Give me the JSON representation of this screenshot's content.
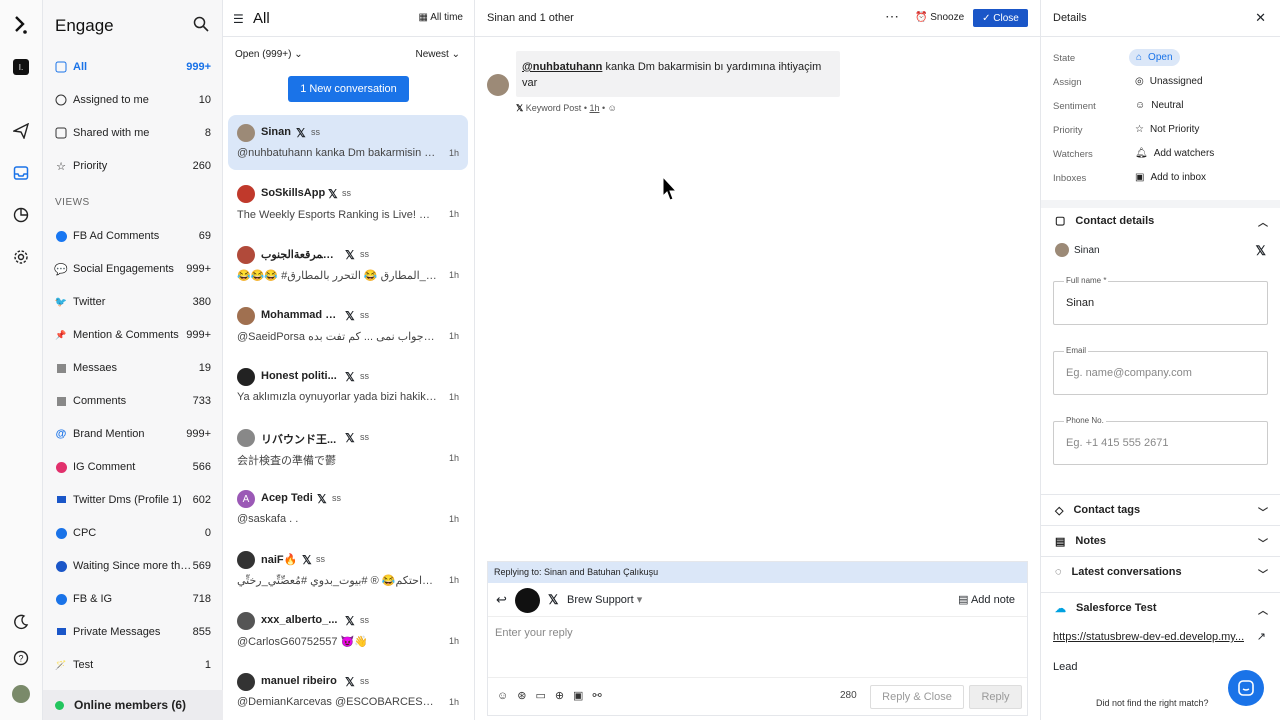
{
  "sidebar": {
    "title": "Engage",
    "views_heading": "VIEWS",
    "online": "Online members (6)",
    "items": [
      {
        "label": "All",
        "count": "999+"
      },
      {
        "label": "Assigned to me",
        "count": "10"
      },
      {
        "label": "Shared with me",
        "count": "8"
      },
      {
        "label": "Priority",
        "count": "260"
      }
    ],
    "views": [
      {
        "label": "FB Ad Comments",
        "count": "69",
        "icon": "facebook-icon"
      },
      {
        "label": "Social Engagements",
        "count": "999+",
        "icon": "speech-bubble-icon"
      },
      {
        "label": "Twitter",
        "count": "380",
        "icon": "twitter-icon"
      },
      {
        "label": "Mention & Comments",
        "count": "999+",
        "icon": "pin-icon"
      },
      {
        "label": "Messaes",
        "count": "19",
        "icon": "list-icon"
      },
      {
        "label": "Comments",
        "count": "733",
        "icon": "list-icon"
      },
      {
        "label": "Brand Mention",
        "count": "999+",
        "icon": "at-icon"
      },
      {
        "label": "IG Comment",
        "count": "566",
        "icon": "instagram-icon"
      },
      {
        "label": "Twitter Dms (Profile 1)",
        "count": "602",
        "icon": "chat-icon"
      },
      {
        "label": "CPC",
        "count": "0",
        "icon": "dollar-icon"
      },
      {
        "label": "Waiting Since more tha...",
        "count": "569",
        "icon": "clock-icon"
      },
      {
        "label": "FB & IG",
        "count": "718",
        "icon": "globe-icon"
      },
      {
        "label": "Private Messages",
        "count": "855",
        "icon": "chat-icon"
      },
      {
        "label": "Test",
        "count": "1",
        "icon": "wand-icon"
      }
    ]
  },
  "list": {
    "title": "All",
    "all_time": "All time",
    "filter": "Open (999+)",
    "sort": "Newest",
    "new_btn": "1 New conversation",
    "convs": [
      {
        "name": "Sinan",
        "ss": "ss",
        "preview": "@nuhbatuhann kanka Dm bakarmisin bı...",
        "time": "1h",
        "color": "#9c8a77"
      },
      {
        "name": "SoSkillsApp",
        "ss": "ss",
        "preview": "The Weekly Esports Ranking is Live! 🌟...",
        "time": "1h",
        "color": "#c0392b"
      },
      {
        "name": "صمرقعةالجنوب✌️...",
        "ss": "ss",
        "preview": "😂😂😂 #حادث_فلم_المطارق 😂 التحرر بالمطارق...",
        "time": "1h",
        "color": "#b14a3a"
      },
      {
        "name": "Mohammad S...",
        "ss": "ss",
        "preview": "@SaeidPorsa یه اینجوری جواب نمی ... کم تفت بده!",
        "time": "1h",
        "color": "#a07050"
      },
      {
        "name": "Honest politi...",
        "ss": "ss",
        "preview": "Ya aklımızla oynuyorlar yada bizi hakika...",
        "time": "1h",
        "color": "#222"
      },
      {
        "name": "リバウンド王...",
        "ss": "ss",
        "preview": "会計検査の準備で鬱",
        "time": "1h",
        "color": "#888"
      },
      {
        "name": "Acep Tedi",
        "ss": "ss",
        "preview": "@saskafa . .",
        "time": "1h",
        "color": "#9b59b6",
        "initial": "A"
      },
      {
        "name": "naiF🔥",
        "ss": "ss",
        "preview": "اسمع اقتراحتكم😂 ® #بيوت_بدوي #مُعصِّتِّي_رختِّي",
        "time": "1h",
        "color": "#333"
      },
      {
        "name": "xxx_alberto_...",
        "ss": "ss",
        "preview": "@CarlosG60752557 😈👋",
        "time": "1h",
        "color": "#555"
      },
      {
        "name": "manuel ribeiro",
        "ss": "ss",
        "preview": "@DemianKarcevas @ESCOBARCESARE ...",
        "time": "1h",
        "color": "#333"
      }
    ]
  },
  "conversation": {
    "title": "Sinan and 1 other",
    "snooze": "Snooze",
    "close": "Close",
    "message": {
      "mention": "@nuhbatuhann",
      "text": " kanka Dm bakarmisin bı yardımına ihtiyaçim var"
    },
    "meta": {
      "source": "Keyword Post",
      "time": "1h"
    },
    "reply": {
      "replying_to": "Replying to: Sinan and Batuhan Çalıkuşu",
      "account": "Brew Support",
      "add_note": "Add note",
      "placeholder": "Enter your reply",
      "chars": "280",
      "reply_close": "Reply & Close",
      "reply": "Reply"
    }
  },
  "details": {
    "title": "Details",
    "props": [
      {
        "label": "State",
        "value": "Open"
      },
      {
        "label": "Assign",
        "value": "Unassigned"
      },
      {
        "label": "Sentiment",
        "value": "Neutral"
      },
      {
        "label": "Priority",
        "value": "Not Priority"
      },
      {
        "label": "Watchers",
        "value": "Add watchers"
      },
      {
        "label": "Inboxes",
        "value": "Add to inbox"
      }
    ],
    "contact_title": "Contact details",
    "contact_name": "Sinan",
    "full_name_label": "Full name *",
    "full_name": "Sinan",
    "email_label": "Email",
    "email_ph": "Eg. name@company.com",
    "phone_label": "Phone No.",
    "phone_ph": "Eg. +1 415 555 2671",
    "tags": "Contact tags",
    "notes": "Notes",
    "latest": "Latest conversations",
    "sf_title": "Salesforce Test",
    "sf_link": "https://statusbrew-dev-ed.develop.my...",
    "lead": "Lead",
    "not_found": "Did not find the right match?"
  },
  "colors": {
    "accent": "#1a73e8",
    "selected_bg": "#dbe7f8",
    "online": "#22c55e"
  }
}
